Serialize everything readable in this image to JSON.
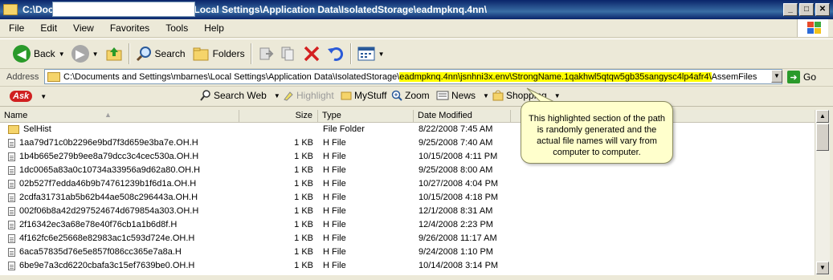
{
  "window": {
    "title": "C:\\Documents and Settings\\mbarnes\\Local Settings\\Application Data\\IsolatedStorage\\eadmpknq.4nn\\",
    "minimize": "_",
    "maximize": "□",
    "close": "✕"
  },
  "menu": [
    "File",
    "Edit",
    "View",
    "Favorites",
    "Tools",
    "Help"
  ],
  "toolbar": {
    "back": "Back",
    "search": "Search",
    "folders": "Folders"
  },
  "address": {
    "label": "Address",
    "path_prefix": "C:\\Documents and Settings\\mbarnes\\Local Settings\\Application Data\\IsolatedStorage\\",
    "path_highlight": "eadmpknq.4nn\\jsnhni3x.env\\StrongName.1qakhwl5qtqw5gb35sangysc4lp4afr4\\",
    "path_suffix": "AssemFiles",
    "go": "Go"
  },
  "askbar": {
    "logo": "Ask",
    "search_web": "Search Web",
    "highlight": "Highlight",
    "mystuff": "MyStuff",
    "zoom": "Zoom",
    "news": "News",
    "shopping": "Shopping"
  },
  "columns": {
    "name": "Name",
    "size": "Size",
    "type": "Type",
    "date": "Date Modified"
  },
  "files": [
    {
      "name": "SelHist",
      "size": "",
      "type": "File Folder",
      "date": "8/22/2008 7:45 AM",
      "kind": "folder"
    },
    {
      "name": "1aa79d71c0b2296e9bd7f3d659e3ba7e.OH.H",
      "size": "1 KB",
      "type": "H File",
      "date": "9/25/2008 7:40 AM",
      "kind": "file"
    },
    {
      "name": "1b4b665e279b9ee8a79dcc3c4cec530a.OH.H",
      "size": "1 KB",
      "type": "H File",
      "date": "10/15/2008 4:11 PM",
      "kind": "file"
    },
    {
      "name": "1dc0065a83a0c10734a33956a9d62a80.OH.H",
      "size": "1 KB",
      "type": "H File",
      "date": "9/25/2008 8:00 AM",
      "kind": "file"
    },
    {
      "name": "02b527f7edda46b9b74761239b1f6d1a.OH.H",
      "size": "1 KB",
      "type": "H File",
      "date": "10/27/2008 4:04 PM",
      "kind": "file"
    },
    {
      "name": "2cdfa31731ab5b62b44ae508c296443a.OH.H",
      "size": "1 KB",
      "type": "H File",
      "date": "10/15/2008 4:18 PM",
      "kind": "file"
    },
    {
      "name": "002f06b8a42d297524674d679854a303.OH.H",
      "size": "1 KB",
      "type": "H File",
      "date": "12/1/2008 8:31 AM",
      "kind": "file"
    },
    {
      "name": "2f16342ec3a68e78e40f76cb1a1b6d8f.H",
      "size": "1 KB",
      "type": "H File",
      "date": "12/4/2008 2:23 PM",
      "kind": "file"
    },
    {
      "name": "4f162fc6e25668e82983ac1c593d724e.OH.H",
      "size": "1 KB",
      "type": "H File",
      "date": "9/26/2008 11:17 AM",
      "kind": "file"
    },
    {
      "name": "6aca57835d76e5e857f086cc365e7a8a.H",
      "size": "1 KB",
      "type": "H File",
      "date": "9/24/2008 1:10 PM",
      "kind": "file"
    },
    {
      "name": "6be9e7a3cd6220cbafa3c15ef7639be0.OH.H",
      "size": "1 KB",
      "type": "H File",
      "date": "10/14/2008 3:14 PM",
      "kind": "file"
    }
  ],
  "callout": {
    "text": "This highlighted section of the path is randomly generated and the actual file names will vary from computer to computer."
  }
}
